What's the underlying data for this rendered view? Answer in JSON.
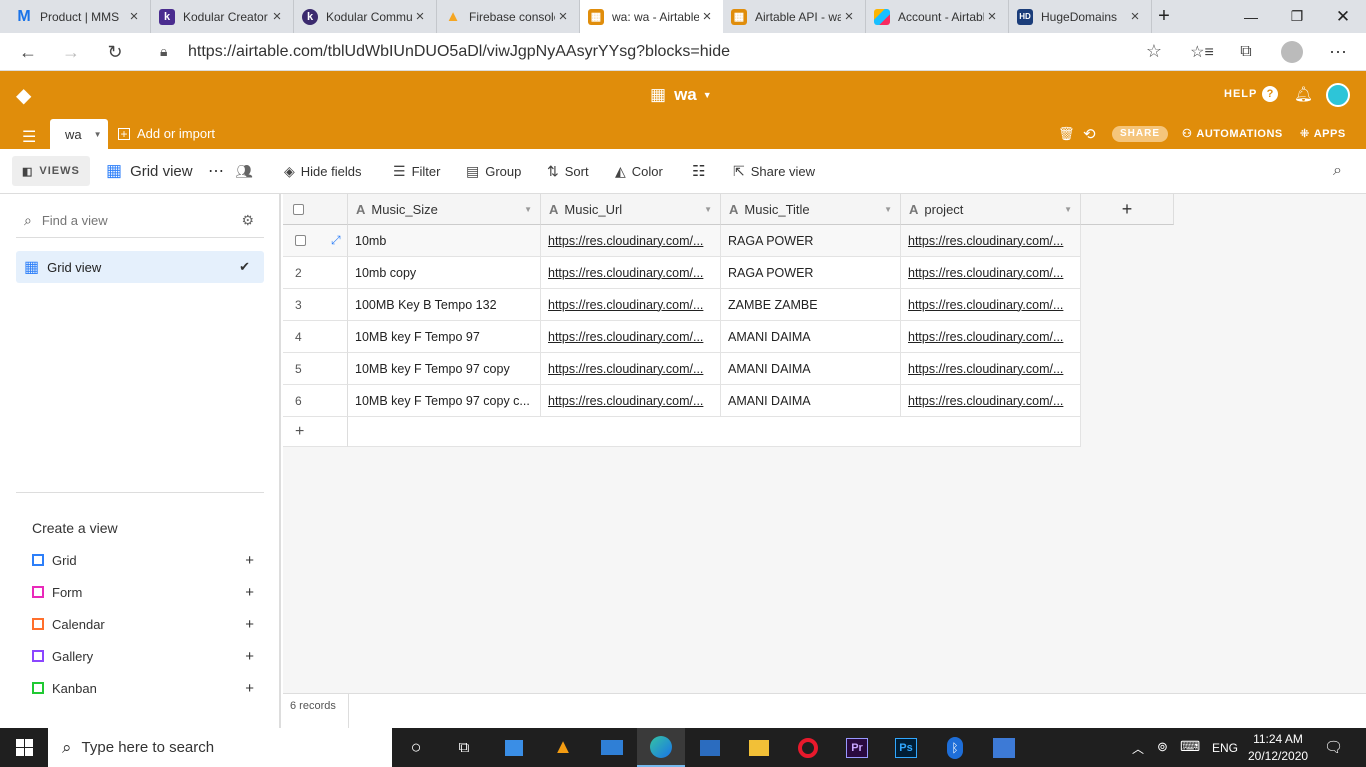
{
  "browser": {
    "tabs": [
      {
        "title": "Product | MMS",
        "icon": "gmail-m-icon"
      },
      {
        "title": "Kodular Creator",
        "icon": "kodular-icon"
      },
      {
        "title": "Kodular Community",
        "icon": "kodular-icon"
      },
      {
        "title": "Firebase console",
        "icon": "firebase-icon"
      },
      {
        "title": "wa: wa - Airtable",
        "icon": "airtable-icon"
      },
      {
        "title": "Airtable API - wa",
        "icon": "airtable-icon"
      },
      {
        "title": "Account - Airtable",
        "icon": "airtable-icon"
      },
      {
        "title": "HugeDomains",
        "icon": "hugedomains-icon"
      }
    ],
    "url": "https://airtable.com/tblUdWbIUnDUO5aDl/viwJgpNyAAsyrYYsg?blocks=hide"
  },
  "header": {
    "base_name": "wa",
    "help": "HELP",
    "table_tab": "wa",
    "add_or_import": "Add or import",
    "share": "SHARE",
    "automations": "AUTOMATIONS",
    "apps": "APPS",
    "accent": "#e08d0b"
  },
  "viewbar": {
    "views": "VIEWS",
    "current_view": "Grid view",
    "hide_fields": "Hide fields",
    "filter": "Filter",
    "group": "Group",
    "sort": "Sort",
    "color": "Color",
    "share_view": "Share view"
  },
  "sidebar": {
    "find_placeholder": "Find a view",
    "views": [
      {
        "label": "Grid view",
        "selected": true
      }
    ],
    "create_title": "Create a view",
    "create_items": [
      {
        "label": "Grid",
        "color": "#2d7ff9"
      },
      {
        "label": "Form",
        "color": "#e929ba"
      },
      {
        "label": "Calendar",
        "color": "#ff6f2c"
      },
      {
        "label": "Gallery",
        "color": "#8b46ff"
      },
      {
        "label": "Kanban",
        "color": "#20c933"
      }
    ]
  },
  "grid": {
    "columns": [
      "Music_Size",
      "Music_Url",
      "Music_Title",
      "project"
    ],
    "rows": [
      {
        "num": "",
        "size": "10mb",
        "url": "https://res.cloudinary.com/...",
        "title": "RAGA POWER",
        "project": "https://res.cloudinary.com/..."
      },
      {
        "num": "2",
        "size": "10mb copy",
        "url": "https://res.cloudinary.com/...",
        "title": "RAGA POWER",
        "project": "https://res.cloudinary.com/..."
      },
      {
        "num": "3",
        "size": "100MB Key B Tempo 132",
        "url": "https://res.cloudinary.com/...",
        "title": "ZAMBE ZAMBE",
        "project": "https://res.cloudinary.com/..."
      },
      {
        "num": "4",
        "size": "10MB key F Tempo 97",
        "url": "https://res.cloudinary.com/...",
        "title": "AMANI DAIMA",
        "project": "https://res.cloudinary.com/..."
      },
      {
        "num": "5",
        "size": "10MB key F Tempo 97 copy",
        "url": "https://res.cloudinary.com/...",
        "title": "AMANI DAIMA",
        "project": "https://res.cloudinary.com/..."
      },
      {
        "num": "6",
        "size": "10MB key F Tempo 97 copy c...",
        "url": "https://res.cloudinary.com/...",
        "title": "AMANI DAIMA",
        "project": "https://res.cloudinary.com/..."
      }
    ],
    "record_count": "6 records"
  },
  "taskbar": {
    "search_placeholder": "Type here to search",
    "lang": "ENG",
    "time": "11:24 AM",
    "date": "20/12/2020"
  }
}
